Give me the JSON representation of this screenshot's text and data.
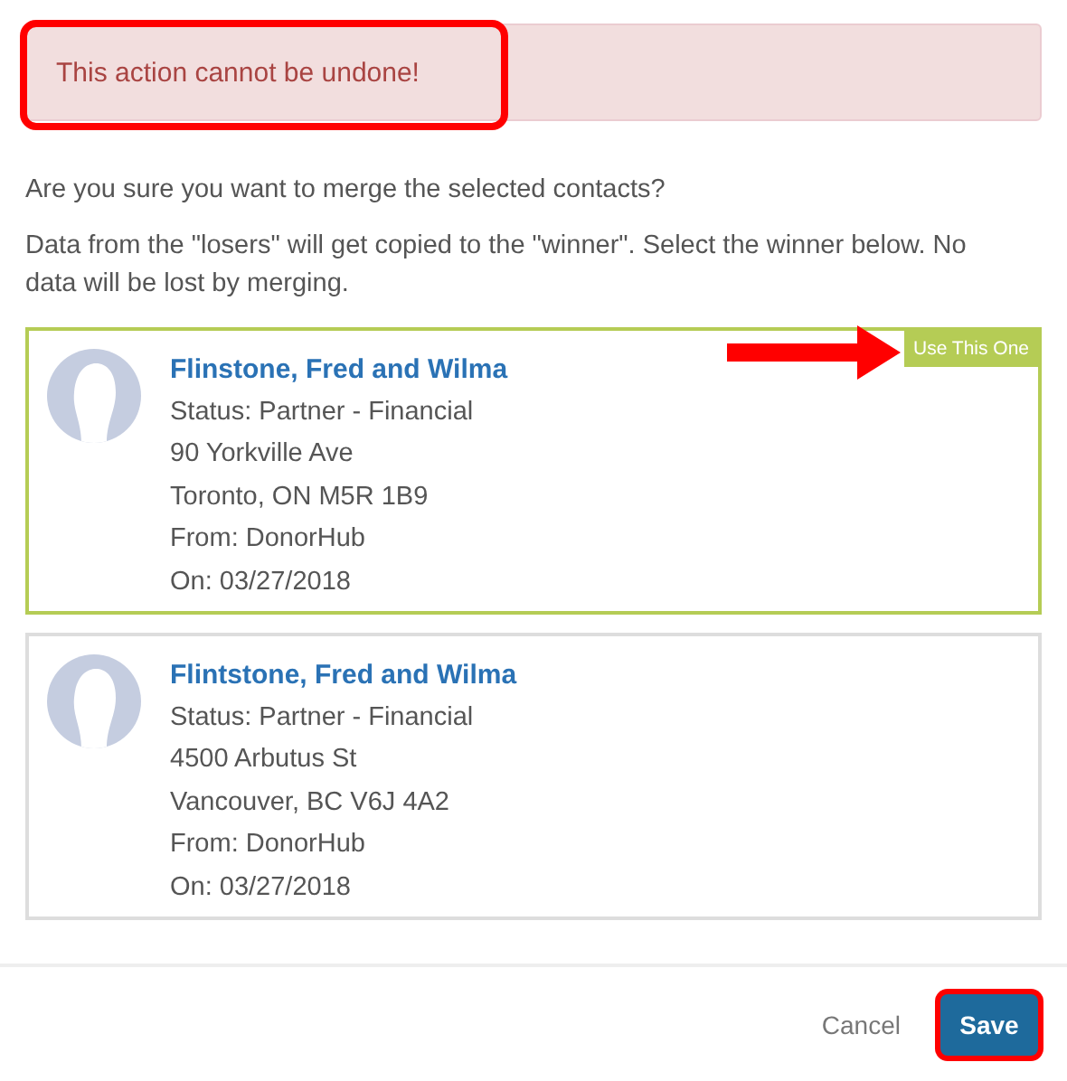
{
  "alert": {
    "text": "This action cannot be undone!",
    "highlighted": true
  },
  "question": "Are you sure you want to merge the selected contacts?",
  "explanation": "Data from the \"losers\" will get copied to the \"winner\". Select the winner below. No data will be lost by merging.",
  "contacts": [
    {
      "name": "Flinstone, Fred and Wilma",
      "lines": [
        "Status: Partner - Financial",
        "90 Yorkville Ave",
        "Toronto, ON M5R 1B9",
        "From: DonorHub",
        "On: 03/27/2018"
      ],
      "selected": true,
      "badge": "Use This One",
      "pointed_at": true
    },
    {
      "name": "Flintstone, Fred and Wilma",
      "lines": [
        "Status: Partner - Financial",
        "4500 Arbutus St",
        "Vancouver, BC V6J 4A2",
        "From: DonorHub",
        "On: 03/27/2018"
      ],
      "selected": false,
      "pointed_at": false
    }
  ],
  "buttons": [
    {
      "label": "Cancel",
      "kind": "link",
      "highlighted": false
    },
    {
      "label": "Save",
      "kind": "primary",
      "highlighted": true
    }
  ]
}
